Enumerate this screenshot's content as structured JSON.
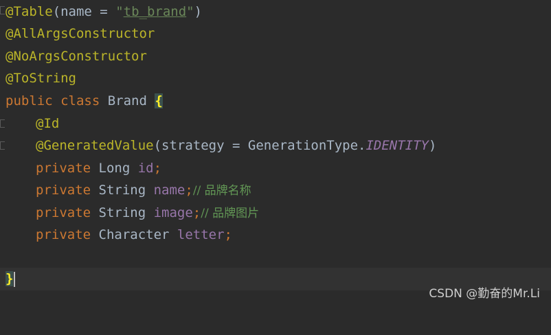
{
  "code": {
    "l1": {
      "anno": "@Table",
      "open": "(",
      "param": "name",
      "eq": " = ",
      "q1": "\"",
      "str": "tb_brand",
      "q2": "\"",
      "close": ")"
    },
    "l2": {
      "anno": "@AllArgsConstructor"
    },
    "l3": {
      "anno": "@NoArgsConstructor"
    },
    "l4": {
      "anno": "@ToString"
    },
    "l5": {
      "kw": "public class ",
      "name": "Brand ",
      "brace": "{"
    },
    "l6": {
      "anno": "@Id"
    },
    "l7": {
      "anno": "@GeneratedValue",
      "open": "(",
      "param": "strategy = GenerationType.",
      "static": "IDENTITY",
      "close": ")"
    },
    "l8": {
      "kw": "private ",
      "type": "Long ",
      "field": "id",
      "semi": ";"
    },
    "l9": {
      "kw": "private ",
      "type": "String ",
      "field": "name",
      "semi": ";",
      "comment": "// 品牌名称"
    },
    "l10": {
      "kw": "private ",
      "type": "String ",
      "field": "image",
      "semi": ";",
      "comment": "// 品牌图片"
    },
    "l11": {
      "kw": "private ",
      "type": "Character ",
      "field": "letter",
      "semi": ";"
    },
    "l13": {
      "brace": "}"
    }
  },
  "watermark": "CSDN @勤奋的Mr.Li",
  "colors": {
    "background": "#2b2b2b",
    "annotation": "#bbb529",
    "keyword": "#cc7832",
    "field": "#9876aa",
    "string": "#6a8759",
    "comment": "#629755"
  }
}
